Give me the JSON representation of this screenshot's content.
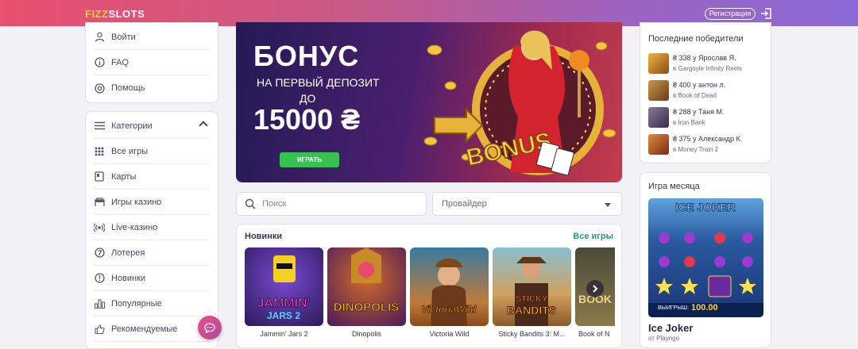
{
  "header": {
    "logo_part1": "FIZZ",
    "logo_part2": "SLOTS",
    "register_label": "Регистрация",
    "login_icon": "login-icon"
  },
  "sidebar_top": {
    "items": [
      {
        "label": "Войти",
        "icon": "user-icon"
      },
      {
        "label": "FAQ",
        "icon": "info-icon"
      },
      {
        "label": "Помощь",
        "icon": "lifebuoy-icon"
      }
    ]
  },
  "sidebar_categories": {
    "header_label": "Категории",
    "items": [
      {
        "label": "Все игры",
        "icon": "grid-icon"
      },
      {
        "label": "Карты",
        "icon": "cards-icon"
      },
      {
        "label": "Игры казино",
        "icon": "casino-icon"
      },
      {
        "label": "Live-казино",
        "icon": "live-icon"
      },
      {
        "label": "Лотерея",
        "icon": "lottery-icon"
      },
      {
        "label": "Новинки",
        "icon": "new-icon"
      },
      {
        "label": "Популярные",
        "icon": "chart-icon"
      },
      {
        "label": "Рекомендуемые",
        "icon": "thumbs-up-icon"
      }
    ]
  },
  "banner": {
    "line1": "БОНУС",
    "line2": "НА ПЕРВЫЙ ДЕПОЗИТ",
    "line3": "ДО",
    "line4": "15000 ₴",
    "play_label": "ИГРАТЬ",
    "sign_text": "BONUS"
  },
  "filters": {
    "search_placeholder": "Поиск",
    "provider_label": "Провайдер"
  },
  "new_games": {
    "title": "Новинки",
    "all_label": "Все игры",
    "games": [
      {
        "name": "Jammin' Jars 2",
        "color": "#3b2a7a"
      },
      {
        "name": "Dinopolis",
        "color": "#6a3a8a"
      },
      {
        "name": "Victoria Wild",
        "color": "#b06a2a"
      },
      {
        "name": "Sticky Bandits 3: M...",
        "color": "#c89a3a"
      },
      {
        "name": "Book of N",
        "color": "#7a6a3a"
      }
    ]
  },
  "winners": {
    "title": "Последние победители",
    "items": [
      {
        "amount": "₴ 338 у Ярослав Я.",
        "game": "в Gargoyle Infinity Reels",
        "color": "#d89a2a"
      },
      {
        "amount": "₴ 400 у антон л.",
        "game": "в Book of Dead",
        "color": "#a8742a"
      },
      {
        "amount": "₴ 288 у Таня М.",
        "game": "в Iron Bank",
        "color": "#6a5a7a"
      },
      {
        "amount": "₴ 375 у Александр К.",
        "game": "в Money Train 2",
        "color": "#c26a2a"
      }
    ]
  },
  "game_of_month": {
    "title": "Игра месяца",
    "name": "Ice Joker",
    "provider": "от Playngo",
    "image_logo": "ICE JOKER",
    "win_label": "ВЫИГРЫШ:",
    "win_value": "100.00"
  }
}
